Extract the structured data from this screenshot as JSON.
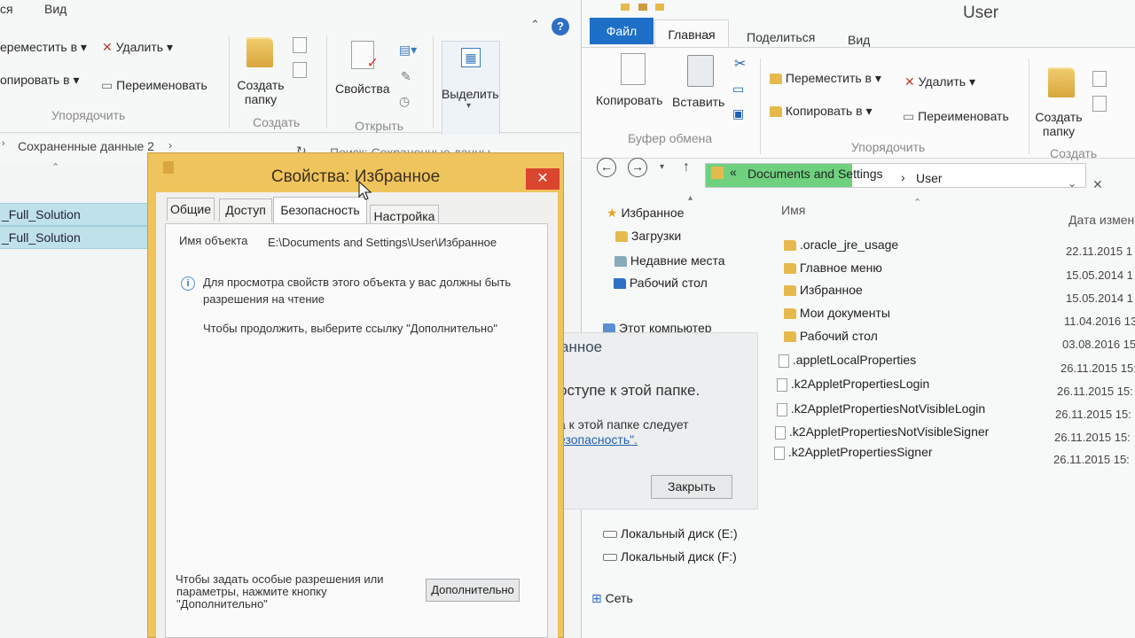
{
  "left": {
    "tabs": [
      "ся",
      "Вид"
    ],
    "ribbon": {
      "move_to": "ереместить в",
      "copy_to": "опировать в",
      "delete": "Удалить",
      "rename": "Переименовать",
      "organize_group": "Упорядочить",
      "new_folder": "Создать\nпапку",
      "create_group": "Создать",
      "properties": "Свойства",
      "open_group": "Открыть",
      "select": "Выделить"
    },
    "address": "Сохраненные данные 2",
    "search_placeholder": "Поиск: Сохраненные данны",
    "rows": [
      "_Full_Solution",
      "_Full_Solution"
    ]
  },
  "right": {
    "title": "User",
    "tabs": {
      "file": "Файл",
      "home": "Главная",
      "share": "Поделиться",
      "view": "Вид"
    },
    "ribbon": {
      "copy": "Копировать",
      "paste": "Вставить",
      "clipboard_group": "Буфер обмена",
      "move_to": "Переместить в",
      "copy_to": "Копировать в",
      "delete": "Удалить",
      "rename": "Переименовать",
      "organize_group": "Упорядочить",
      "new_folder": "Создать\nпапку",
      "create_group": "Создать"
    },
    "breadcrumb": {
      "root_arrow": "«",
      "segment1": "Documents and Settings",
      "separator": "›",
      "segment2": "User"
    },
    "tree": {
      "favorites": "Избранное",
      "downloads": "Загрузки",
      "recent": "Недавние места",
      "desktop": "Рабочий стол",
      "computer": "Этот компьютер",
      "disk_e": "Локальный диск (E:)",
      "disk_f": "Локальный диск (F:)",
      "network": "Сеть"
    },
    "columns": {
      "name": "Имя",
      "date": "Дата измен"
    },
    "files": [
      {
        "name": ".oracle_jre_usage",
        "date": "22.11.2015 1",
        "type": "folder"
      },
      {
        "name": "Главное меню",
        "date": "15.05.2014 1",
        "type": "folder"
      },
      {
        "name": "Избранное",
        "date": "15.05.2014 1",
        "type": "folder"
      },
      {
        "name": "Мои документы",
        "date": "11.04.2016 13",
        "type": "folder"
      },
      {
        "name": "Рабочий стол",
        "date": "03.08.2016 15",
        "type": "folder"
      },
      {
        "name": ".appletLocalProperties",
        "date": "26.11.2015 15:",
        "type": "file"
      },
      {
        "name": ".k2AppletPropertiesLogin",
        "date": "26.11.2015 15:",
        "type": "file"
      },
      {
        "name": ".k2AppletPropertiesNotVisibleLogin",
        "date": "26.11.2015 15:",
        "type": "file"
      },
      {
        "name": ".k2AppletPropertiesNotVisibleSigner",
        "date": "26.11.2015 15:",
        "type": "file"
      },
      {
        "name": ".k2AppletPropertiesSigner",
        "date": "26.11.2015 15:",
        "type": "file"
      }
    ],
    "error_pane": {
      "title": "анное",
      "line1": "оступе к этой папке.",
      "line2": "а к этой папке следует",
      "link": "езопасность\".",
      "close_button": "Закрыть"
    }
  },
  "dialog": {
    "title": "Свойства: Избранное",
    "close": "✕",
    "tabs": [
      "Общие",
      "Доступ",
      "Безопасность",
      "Настройка"
    ],
    "object_label": "Имя объекта",
    "object_value": "E:\\Documents and Settings\\User\\Избранное",
    "info_line1": "Для просмотра свойств этого объекта у вас должны быть",
    "info_line2": "разрешения на чтение",
    "continue_text": "Чтобы продолжить, выберите ссылку \"Дополнительно\"",
    "footer_line1": "Чтобы задать особые разрешения или",
    "footer_line2": "параметры, нажмите кнопку",
    "footer_line3": "\"Дополнительно\"",
    "advanced_button": "Дополнительно"
  },
  "colors": {
    "file_tab": "#1e6fc8",
    "dialog_frame": "#f0c45d",
    "close_red": "#d9452f",
    "selection": "#bfe1ea",
    "breadcrumb_green": "#6fd17e"
  }
}
